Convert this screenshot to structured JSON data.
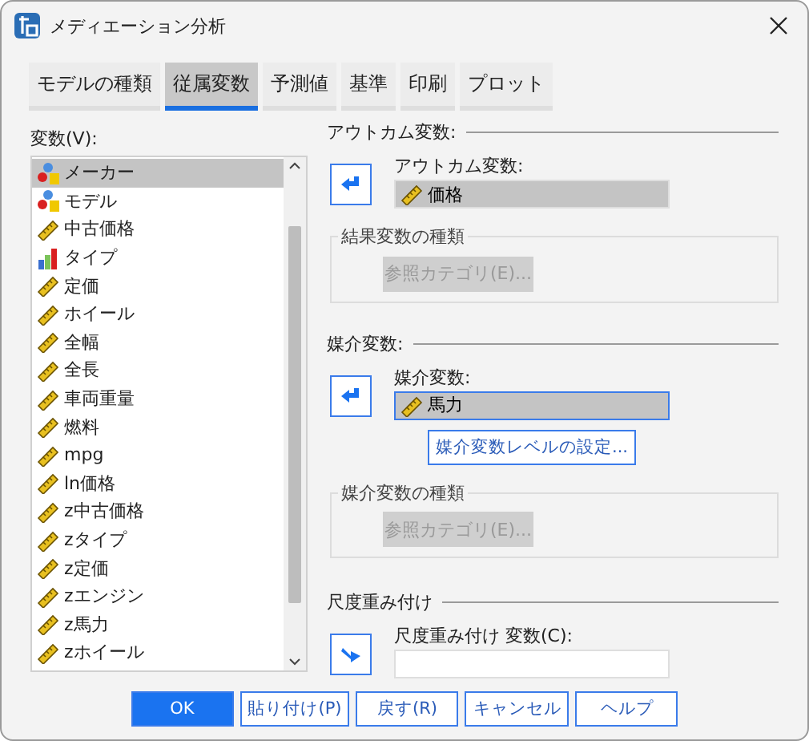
{
  "window": {
    "title": "メディエーション分析"
  },
  "tabs": [
    {
      "label": "モデルの種類",
      "selected": false
    },
    {
      "label": "従属変数",
      "selected": true
    },
    {
      "label": "予測値",
      "selected": false
    },
    {
      "label": "基準",
      "selected": false
    },
    {
      "label": "印刷",
      "selected": false
    },
    {
      "label": "プロット",
      "selected": false
    }
  ],
  "variables": {
    "label": "変数(V):",
    "items": [
      {
        "name": "メーカー",
        "kind": "nominal",
        "selected": true
      },
      {
        "name": "モデル",
        "kind": "nominal",
        "selected": false
      },
      {
        "name": "中古価格",
        "kind": "scale",
        "selected": false
      },
      {
        "name": "タイプ",
        "kind": "ordinal",
        "selected": false
      },
      {
        "name": "定価",
        "kind": "scale",
        "selected": false
      },
      {
        "name": "ホイール",
        "kind": "scale",
        "selected": false
      },
      {
        "name": "全幅",
        "kind": "scale",
        "selected": false
      },
      {
        "name": "全長",
        "kind": "scale",
        "selected": false
      },
      {
        "name": "車両重量",
        "kind": "scale",
        "selected": false
      },
      {
        "name": "燃料",
        "kind": "scale",
        "selected": false
      },
      {
        "name": "mpg",
        "kind": "scale",
        "selected": false
      },
      {
        "name": "ln価格",
        "kind": "scale",
        "selected": false
      },
      {
        "name": "z中古価格",
        "kind": "scale",
        "selected": false
      },
      {
        "name": "zタイプ",
        "kind": "scale",
        "selected": false
      },
      {
        "name": "z定価",
        "kind": "scale",
        "selected": false
      },
      {
        "name": "zエンジン",
        "kind": "scale",
        "selected": false
      },
      {
        "name": "z馬力",
        "kind": "scale",
        "selected": false
      },
      {
        "name": "zホイール",
        "kind": "scale",
        "selected": false
      }
    ]
  },
  "sections": [
    {
      "title": "アウトカム変数:",
      "arrow_button": {
        "kind": "left"
      },
      "field_label": "アウトカム変数:",
      "value": {
        "text": "価格",
        "kind": "scale"
      },
      "focused": false,
      "group": {
        "title": "結果変数の種類",
        "button": "参照カテゴリ(E)...",
        "disabled": true
      }
    },
    {
      "title": "媒介変数:",
      "arrow_button": {
        "kind": "left"
      },
      "field_label": "媒介変数:",
      "value": {
        "text": "馬力",
        "kind": "scale"
      },
      "focused": true,
      "extra_button": "媒介変数レベルの設定...",
      "group": {
        "title": "媒介変数の種類",
        "button": "参照カテゴリ(E)...",
        "disabled": true
      }
    },
    {
      "title": "尺度重み付け",
      "arrow_button": {
        "kind": "right"
      },
      "field_label": "尺度重み付け 変数(C):",
      "focused": false
    }
  ],
  "buttons": [
    {
      "label": "OK",
      "kind": "primary"
    },
    {
      "label": "貼り付け(P)",
      "kind": "normal"
    },
    {
      "label": "戻す(R)",
      "kind": "normal"
    },
    {
      "label": "キャンセル",
      "kind": "normal"
    },
    {
      "label": "ヘルプ",
      "kind": "normal"
    }
  ]
}
